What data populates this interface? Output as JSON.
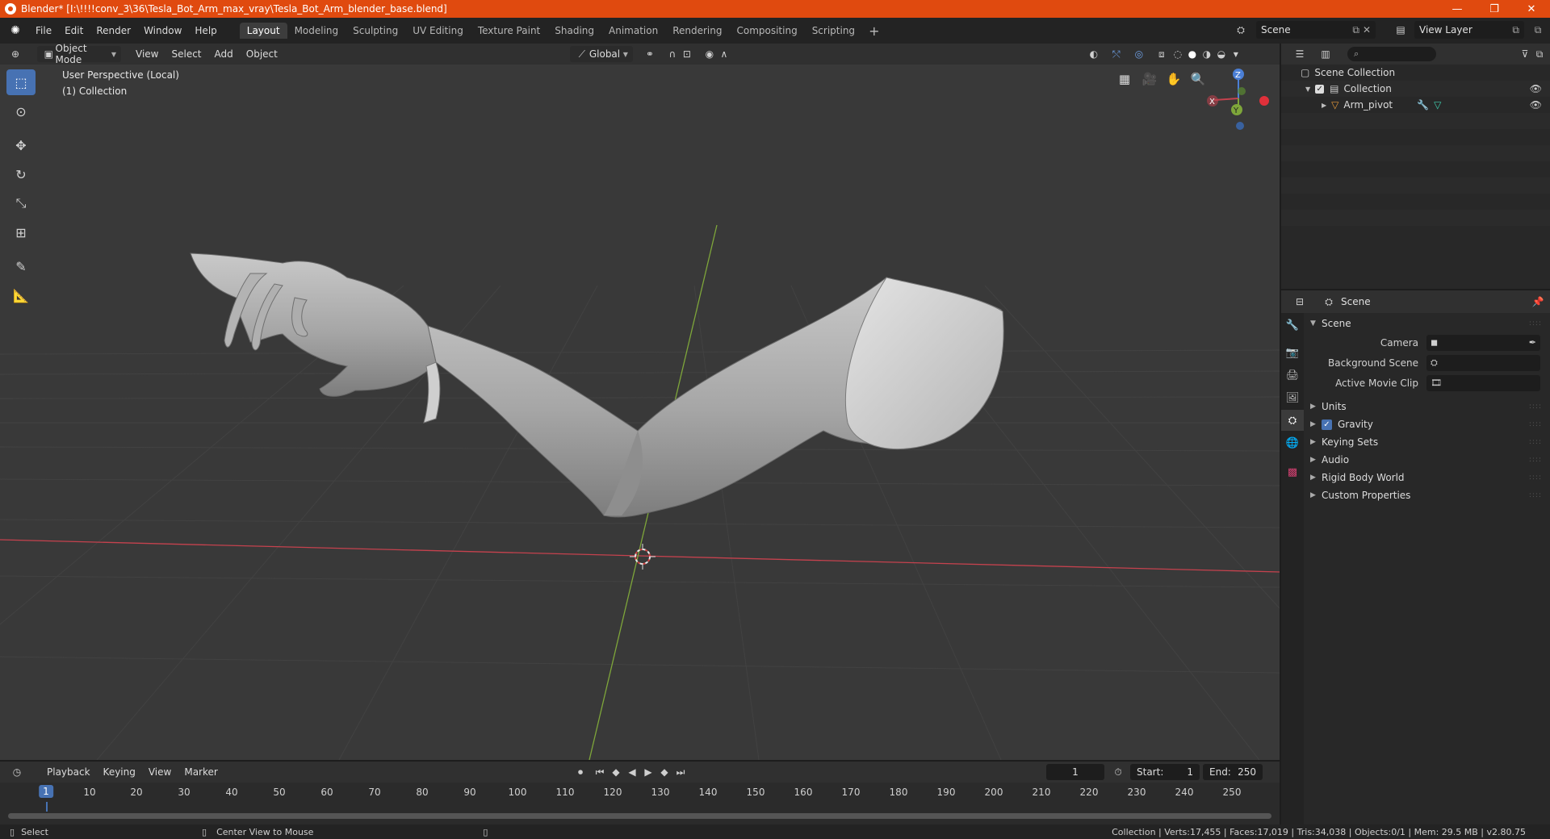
{
  "titlebar": {
    "title": "Blender* [I:\\!!!!conv_3\\36\\Tesla_Bot_Arm_max_vray\\Tesla_Bot_Arm_blender_base.blend]",
    "minimize": "—",
    "maximize": "❐",
    "close": "✕"
  },
  "menubar": {
    "items": [
      "File",
      "Edit",
      "Render",
      "Window",
      "Help"
    ],
    "workspaces": [
      "Layout",
      "Modeling",
      "Sculpting",
      "UV Editing",
      "Texture Paint",
      "Shading",
      "Animation",
      "Rendering",
      "Compositing",
      "Scripting"
    ],
    "add": "+",
    "scene": "Scene",
    "view_layer": "View Layer"
  },
  "viewport": {
    "mode": "Object Mode",
    "menus": [
      "View",
      "Select",
      "Add",
      "Object"
    ],
    "orientation": "Global",
    "info_line1": "User Perspective (Local)",
    "info_line2": "(1) Collection",
    "gizmo": {
      "x": "X",
      "y": "Y",
      "z": "Z"
    }
  },
  "outliner": {
    "scene_collection": "Scene Collection",
    "collection": "Collection",
    "object": "Arm_pivot"
  },
  "properties": {
    "context": "Scene",
    "panel_title": "Scene",
    "camera_label": "Camera",
    "background_scene_label": "Background Scene",
    "active_movie_clip_label": "Active Movie Clip",
    "panels": [
      "Units",
      "Gravity",
      "Keying Sets",
      "Audio",
      "Rigid Body World",
      "Custom Properties"
    ]
  },
  "timeline": {
    "menus": [
      "Playback",
      "Keying",
      "View",
      "Marker"
    ],
    "current_frame": "1",
    "start_label": "Start:",
    "start": "1",
    "end_label": "End:",
    "end": "250",
    "ruler": [
      "10",
      "20",
      "30",
      "40",
      "50",
      "60",
      "70",
      "80",
      "90",
      "100",
      "110",
      "120",
      "130",
      "140",
      "150",
      "160",
      "170",
      "180",
      "190",
      "200",
      "210",
      "220",
      "230",
      "240",
      "250"
    ]
  },
  "statusbar": {
    "left1": "Select",
    "left2": "Center View to Mouse",
    "stats": "Collection | Verts:17,455 | Faces:17,019 | Tris:34,038 | Objects:0/1 | Mem: 29.5 MB | v2.80.75"
  },
  "colors": {
    "title_bar": "#e04a0f",
    "accent": "#4772b3",
    "viewport_bg": "#393939",
    "x_axis": "#c5424e",
    "y_axis": "#7ea63a"
  }
}
